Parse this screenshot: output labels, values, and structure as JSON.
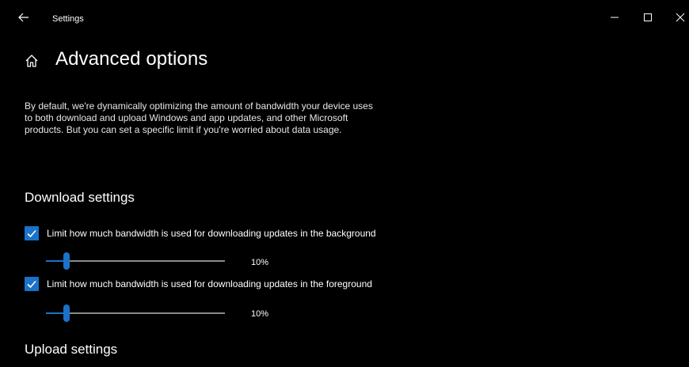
{
  "window": {
    "title": "Settings",
    "back_icon": "arrow-left-icon",
    "controls": [
      "minimize-icon",
      "maximize-icon",
      "close-icon"
    ]
  },
  "header": {
    "home_icon": "home-icon",
    "title": "Advanced options"
  },
  "description": "By default, we're dynamically optimizing the amount of bandwidth your device uses to both download and upload Windows and app updates, and other Microsoft products. But you can set a specific limit if you're worried about data usage.",
  "download_settings": {
    "title": "Download settings",
    "background": {
      "checked": true,
      "label": "Limit how much bandwidth is used for downloading updates in the background",
      "value": 10,
      "value_label": "10%"
    },
    "foreground": {
      "checked": true,
      "label": "Limit how much bandwidth is used for downloading updates in the foreground",
      "value": 10,
      "value_label": "10%"
    }
  },
  "upload_settings": {
    "title": "Upload settings"
  },
  "colors": {
    "background": "#000000",
    "accent": "#1a73c8",
    "track": "#8a8a8a",
    "text": "#ffffff"
  }
}
